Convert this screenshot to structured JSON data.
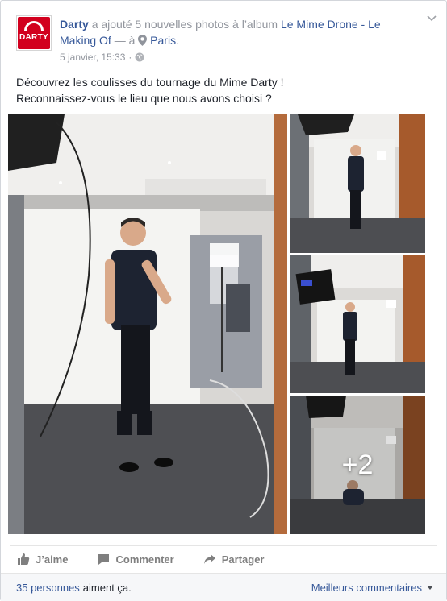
{
  "post": {
    "author": "Darty",
    "action_text": "a ajouté 5 nouvelles photos à l’album",
    "album": "Le Mime Drone - Le Making Of",
    "place_sep": "— à",
    "place": "Paris",
    "date": "5 janvier, 15:33",
    "meta_sep": "·",
    "text_line1": "Découvrez les coulisses du tournage du Mime Darty !",
    "text_line2": "Reconnaissez-vous le lieu que nous avons choisi ?",
    "avatar_text": "DARTY"
  },
  "photos": {
    "more_label": "+2"
  },
  "actions": {
    "like": "J’aime",
    "comment": "Commenter",
    "share": "Partager"
  },
  "footer": {
    "count": "35 personnes",
    "likes_text": "aiment ça.",
    "best_comments": "Meilleurs commentaires"
  },
  "colors": {
    "link": "#365899",
    "brand": "#d2001e",
    "muted": "#90949c"
  }
}
